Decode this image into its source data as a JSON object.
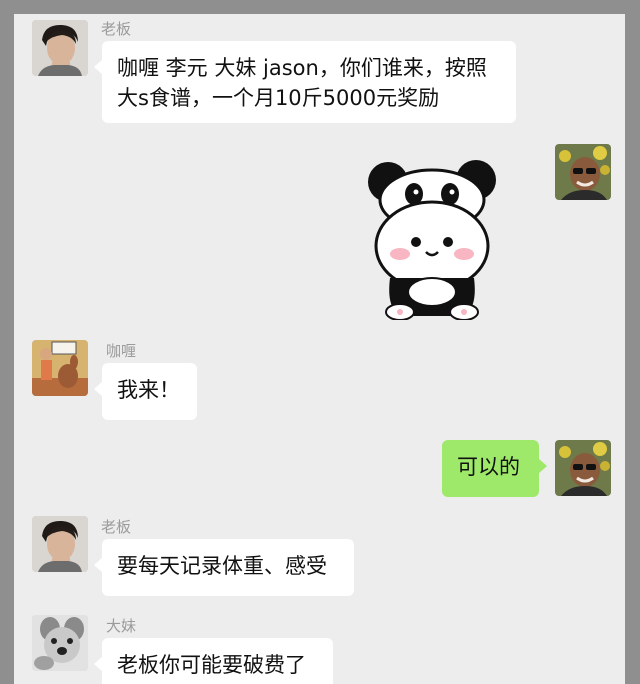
{
  "messages": [
    {
      "sender": "老板",
      "text": "咖喱 李元 大妹 jason，你们谁来，按照大s食谱，一个月10斤5000元奖励"
    },
    {
      "sender": "",
      "sticker": "panda-sticker"
    },
    {
      "sender": "咖喱",
      "text": "我来！"
    },
    {
      "sender": "",
      "text": "可以的"
    },
    {
      "sender": "老板",
      "text": "要每天记录体重、感受"
    },
    {
      "sender": "大妹",
      "text": "老板你可能要破费了"
    }
  ],
  "colors": {
    "incoming_bubble": "#ffffff",
    "outgoing_bubble": "#9ee86a",
    "background": "#ededed"
  }
}
